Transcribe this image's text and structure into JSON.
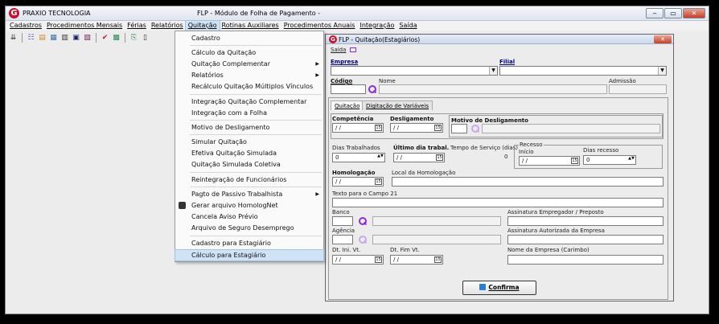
{
  "app": {
    "name": "PRAXIO TECNOLOGIA",
    "window_title": "FLP - Módulo de Folha de Pagamento -",
    "logo_letter": "G"
  },
  "window_buttons": {
    "minimize": "‒",
    "restore": "▭",
    "close": "✕"
  },
  "menubar": [
    "Cadastros",
    "Procedimentos Mensais",
    "Férias",
    "Relatórios",
    "Quitação",
    "Rotinas Auxiliares",
    "Procedimentos Anuais",
    "Integração",
    "Saída"
  ],
  "toolbar_icons": [
    "sort-icon",
    "users-icon",
    "print-icon",
    "calendar-icon",
    "calculator-icon",
    "save-icon",
    "report-icon",
    "check-icon",
    "spreadsheet-icon",
    "export-icon",
    "document-icon"
  ],
  "dropdown": {
    "items": [
      {
        "label": "Cadastro"
      },
      {
        "label": "Cálculo da Quitação"
      },
      {
        "label": "Quitação Complementar",
        "submenu": true
      },
      {
        "label": "Relatórios",
        "submenu": true
      },
      {
        "label": "Recálculo Quitação Múltiplos Vínculos"
      },
      {
        "label": "Integração Quitação Complementar"
      },
      {
        "label": "Integração com a Folha"
      },
      {
        "label": "Motivo de Desligamento"
      },
      {
        "label": "Simular Quitação"
      },
      {
        "label": "Efetiva Quitação Simulada"
      },
      {
        "label": "Quitação Simulada Coletiva"
      },
      {
        "label": "Reintegração de Funcionários"
      },
      {
        "label": "Pagto de Passivo Trabalhista",
        "submenu": true
      },
      {
        "label": "Gerar arquivo HomologNet"
      },
      {
        "label": "Cancela Aviso Prévio"
      },
      {
        "label": "Arquivo de Seguro Desemprego"
      },
      {
        "label": "Cadastro para Estagiário"
      },
      {
        "label": "Cálculo para Estagiário"
      }
    ]
  },
  "dialog": {
    "title": "FLP - Quitação(Estagiários)",
    "close": "✕",
    "saida": "Saída",
    "empresa_label": "Empresa",
    "filial_label": "Filial",
    "codigo_label": "Código",
    "nome_label": "Nome",
    "admissao_label": "Admissão",
    "tabs": [
      "Quitação",
      "Digitação de Variáveis"
    ],
    "competencia_label": "Competência",
    "competencia_value": "/ /",
    "desligamento_label": "Desligamento",
    "desligamento_value": "/ /",
    "motivo_label": "Motivo de Desligamento",
    "dias_trab_label": "Dias Trabalhados",
    "dias_trab_value": "0",
    "ultimo_dia_label": "Último dia trabal.",
    "ultimo_dia_value": "/ /",
    "tempo_servico_label": "Tempo de Serviço (dias)",
    "tempo_servico_value": "0",
    "recesso_label": "Recesso",
    "inicio_label": "Início",
    "inicio_value": "/ /",
    "dias_recesso_label": "Dias recesso",
    "dias_recesso_value": "0",
    "homologacao_label": "Homologação",
    "homologacao_value": "/ /",
    "local_homologacao_label": "Local da Homologação",
    "texto_campo_label": "Texto para o Campo 21",
    "banco_label": "Banco",
    "assin_empregador_label": "Assinatura Empregador / Preposto",
    "agencia_label": "Agência",
    "assin_empresa_label": "Assinatura Autorizada da Empresa",
    "dt_ini_label": "Dt. Ini. Vt.",
    "dt_ini_value": "/ /",
    "dt_fim_label": "Dt. Fim Vt.",
    "dt_fim_value": "/ /",
    "nome_empresa_label": "Nome da Empresa (Carimbo)",
    "confirm_label": "Confirma"
  },
  "colors": {
    "accent": "#c8102e",
    "highlight": "#cfe3f5",
    "lookup": "#8a2be2",
    "label_blue": "#00008b"
  }
}
